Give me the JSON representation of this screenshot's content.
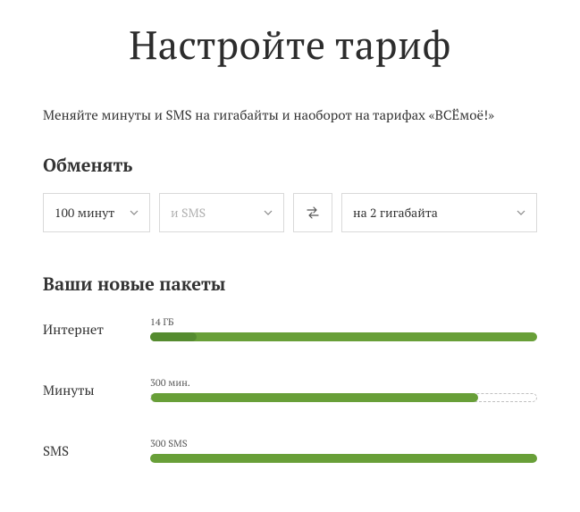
{
  "page": {
    "title": "Настройте тариф",
    "subtitle": "Меняйте минуты и SMS на гигабайты и наоборот на тарифах «ВСЁмоё!»"
  },
  "exchange": {
    "heading": "Обменять",
    "minutes": {
      "value": "100 минут"
    },
    "sms": {
      "placeholder": "и SMS"
    },
    "result": {
      "value": "на 2 гигабайта"
    }
  },
  "packages": {
    "heading": "Ваши новые пакеты",
    "items": [
      {
        "label": "Интернет",
        "value": "14 ГБ",
        "fill": 100,
        "accent": true,
        "track_border": false
      },
      {
        "label": "Минуты",
        "value": "300 мин.",
        "fill": 85,
        "accent": false,
        "track_border": true
      },
      {
        "label": "SMS",
        "value": "300 SMS",
        "fill": 100,
        "accent": false,
        "track_border": false
      }
    ]
  }
}
